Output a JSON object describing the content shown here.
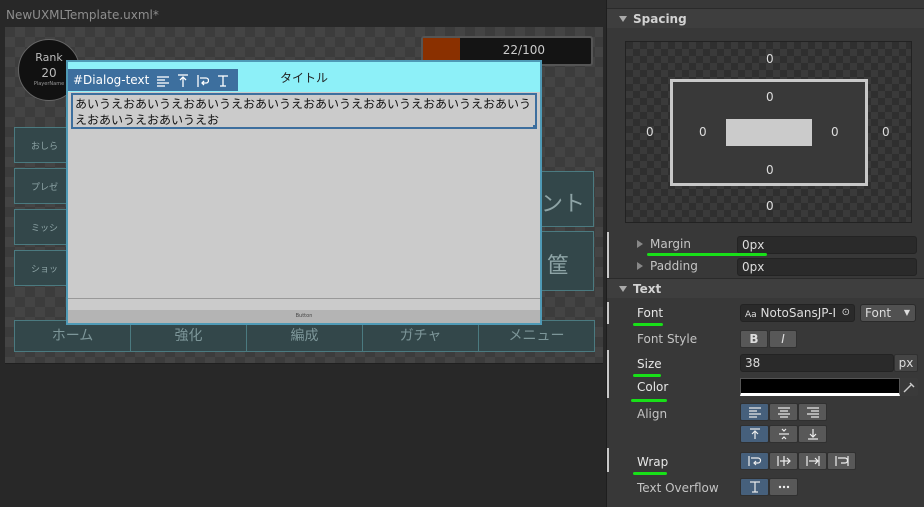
{
  "editor": {
    "document_title": "NewUXMLTemplate.uxml*"
  },
  "canvas": {
    "rank_label": "Rank",
    "rank_value": "20",
    "player_name": "PlayerName",
    "progress_text": "22/100",
    "progress_fraction": 0.22,
    "side_buttons": [
      "おしら",
      "プレゼ",
      "ミッシ",
      "ショッ"
    ],
    "right_panels": [
      "ント",
      "筐"
    ],
    "nav_items": [
      "ホーム",
      "強化",
      "編成",
      "ガチャ",
      "メニュー"
    ],
    "dialog": {
      "title": "タイトル",
      "element_tag": "#Dialog-text",
      "body_text": "あいうえおあいうえおあいうえおあいうえおあいうえおあいうえおあいうえおあいうえおあいうえおあいうえお",
      "footer_text": "Button"
    }
  },
  "inspector": {
    "spacing": {
      "header": "Spacing",
      "margin_top": "0",
      "margin_left": "0",
      "margin_right": "0",
      "margin_bottom": "0",
      "padding_top": "0",
      "padding_left": "0",
      "padding_right": "0",
      "padding_bottom": "0"
    },
    "margin": {
      "label": "Margin",
      "value": "0px"
    },
    "padding": {
      "label": "Padding",
      "value": "0px"
    },
    "text": {
      "header": "Text",
      "font_label": "Font",
      "font_value": "NotoSansJP-I",
      "font_value_prefix": "Aa",
      "font_type": "Font",
      "font_style_label": "Font Style",
      "bold_label": "B",
      "italic_label": "I",
      "size_label": "Size",
      "size_value": "38",
      "size_unit": "px",
      "color_label": "Color",
      "color_value": "#000000",
      "align_label": "Align",
      "wrap_label": "Wrap",
      "overflow_label": "Text Overflow"
    }
  }
}
